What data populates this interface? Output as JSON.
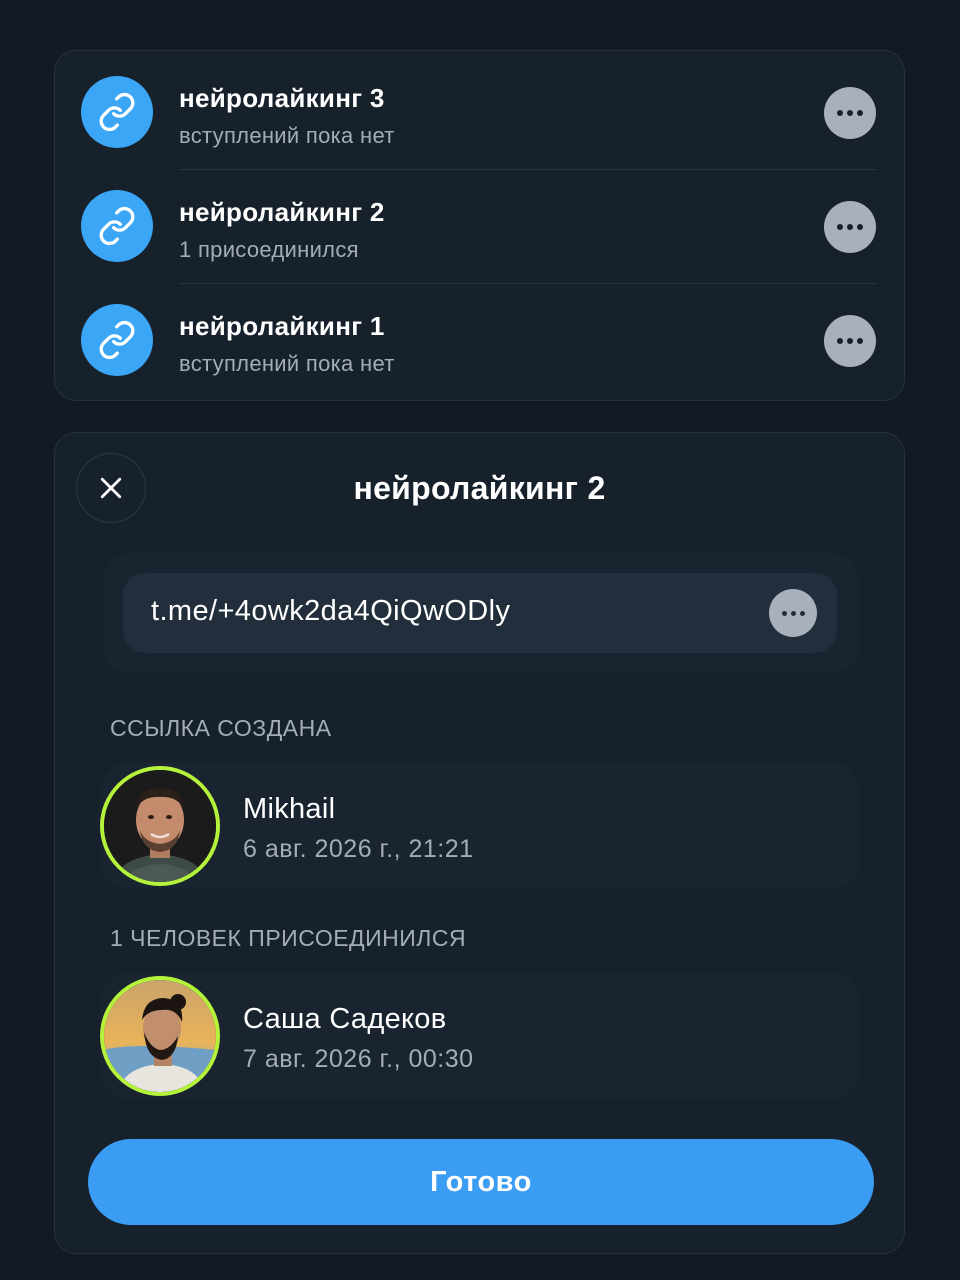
{
  "links": [
    {
      "title": "нейролайкинг 3",
      "subtitle": "вступлений пока нет",
      "icon": "link-icon"
    },
    {
      "title": "нейролайкинг 2",
      "subtitle": "1 присоединился",
      "icon": "link-icon"
    },
    {
      "title": "нейролайкинг 1",
      "subtitle": "вступлений пока нет",
      "icon": "link-icon"
    }
  ],
  "modal": {
    "title": "нейролайкинг 2",
    "url": "t.me/+4owk2da4QiQwODly",
    "created_label": "ССЫЛКА СОЗДАНА",
    "creator": {
      "name": "Mikhail",
      "date": "6 авг. 2026 г., 21:21"
    },
    "joined_label": "1 ЧЕЛОВЕК ПРИСОЕДИНИЛСЯ",
    "joined": [
      {
        "name": "Саша Садеков",
        "date": "7 авг. 2026 г., 00:30"
      }
    ],
    "done_label": "Готово"
  },
  "colors": {
    "background": "#121a23",
    "card": "#17212c",
    "accent": "#3a9cf2",
    "link_icon": "#3aa6f5",
    "avatar_ring": "#b5f23a",
    "secondary_text": "#a3adb8"
  }
}
